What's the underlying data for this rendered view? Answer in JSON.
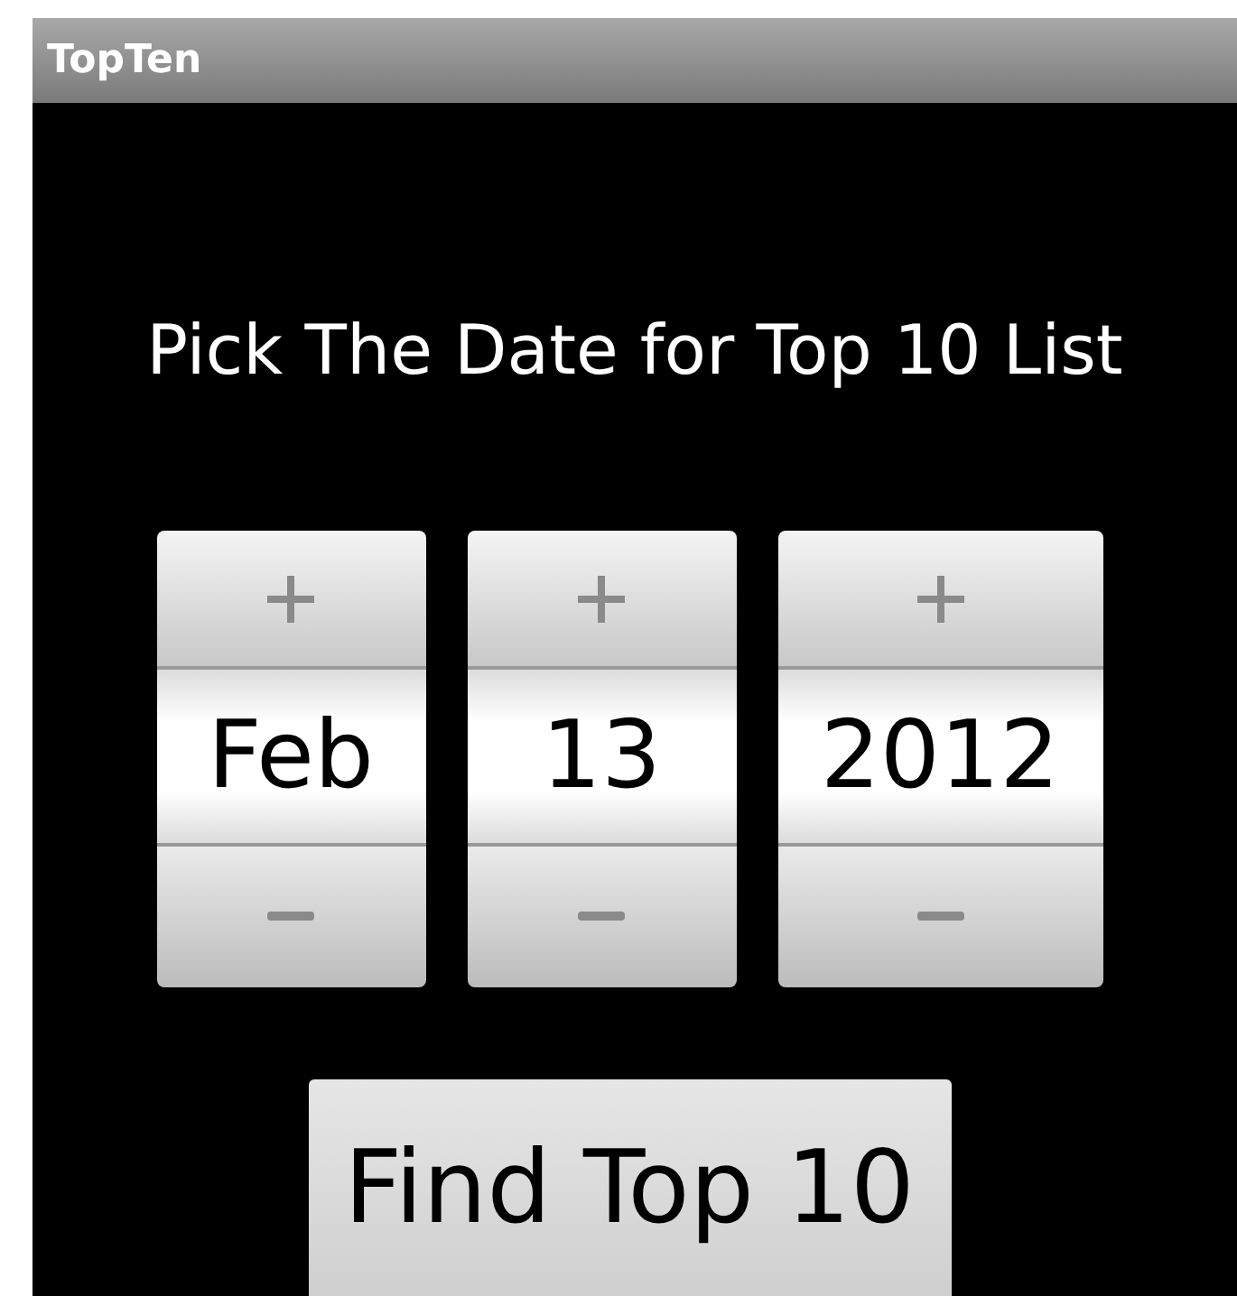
{
  "window": {
    "title": "TopTen"
  },
  "prompt": "Pick The Date for Top 10 List",
  "pickers": [
    {
      "value": "Feb",
      "kind": "month"
    },
    {
      "value": "13",
      "kind": "day"
    },
    {
      "value": "2012",
      "kind": "year"
    }
  ],
  "button": {
    "label": "Find Top 10"
  }
}
